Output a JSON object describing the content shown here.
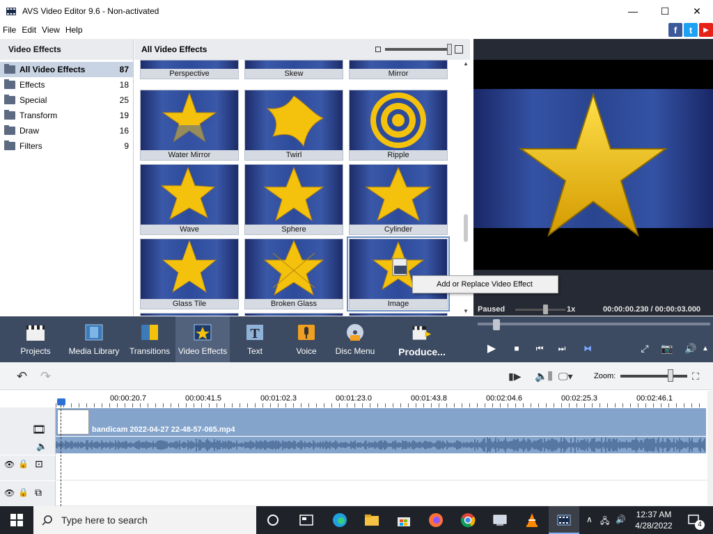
{
  "window": {
    "title": "AVS Video Editor 9.6 - Non-activated",
    "minimize": "—",
    "maximize": "☐",
    "close": "✕"
  },
  "menu": [
    "File",
    "Edit",
    "View",
    "Help"
  ],
  "social": [
    {
      "name": "facebook",
      "glyph": "f",
      "color": "#3b5998"
    },
    {
      "name": "twitter",
      "glyph": "t",
      "color": "#1da1f2"
    },
    {
      "name": "youtube",
      "glyph": "▶",
      "color": "#e62117"
    }
  ],
  "left_panel": {
    "title": "Video Effects",
    "categories": [
      {
        "label": "All Video Effects",
        "count": "87"
      },
      {
        "label": "Effects",
        "count": "18"
      },
      {
        "label": "Special",
        "count": "25"
      },
      {
        "label": "Transform",
        "count": "19"
      },
      {
        "label": "Draw",
        "count": "16"
      },
      {
        "label": "Filters",
        "count": "9"
      }
    ]
  },
  "effects_panel": {
    "title": "All Video Effects",
    "effects": [
      "Perspective",
      "Skew",
      "Mirror",
      "Water Mirror",
      "Twirl",
      "Ripple",
      "Wave",
      "Sphere",
      "Cylinder",
      "Glass Tile",
      "Broken Glass",
      "Image"
    ],
    "selected": "Image"
  },
  "context_menu": {
    "item": "Add or Replace Video Effect"
  },
  "preview": {
    "status": "Paused",
    "speed": "1x",
    "time": "00:00:00.230 / 00:00:03.000"
  },
  "toolbar": {
    "buttons": [
      "Projects",
      "Media Library",
      "Transitions",
      "Video Effects",
      "Text",
      "Voice",
      "Disc Menu",
      "Produce..."
    ],
    "active": "Video Effects"
  },
  "timeline": {
    "zoom_label": "Zoom:",
    "ruler_labels": [
      "00:00:20.7",
      "00:00:41.5",
      "00:01:02.3",
      "00:01:23.0",
      "00:01:43.8",
      "00:02:04.6",
      "00:02:25.3",
      "00:02:46.1"
    ],
    "clip_name": "bandicam 2022-04-27 22-48-57-065.mp4"
  },
  "taskbar": {
    "search_placeholder": "Type here to search",
    "time": "12:37 AM",
    "date": "4/28/2022",
    "notifications": "4"
  },
  "colors": {
    "toolbar_bg": "#3c4a62",
    "accent": "#2c6fd6",
    "clip": "#84a4cc",
    "star": "#f4c20d"
  }
}
